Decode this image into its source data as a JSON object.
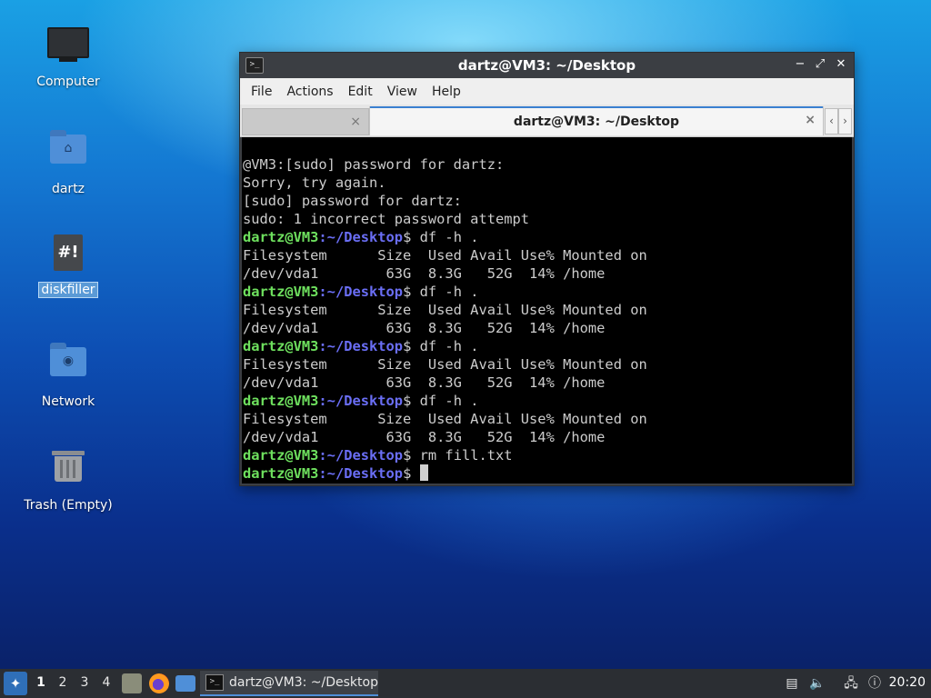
{
  "desktop": {
    "icons": [
      {
        "label": "Computer"
      },
      {
        "label": "dartz"
      },
      {
        "label": "diskfiller",
        "glyph": "#!"
      },
      {
        "label": "Network"
      },
      {
        "label": "Trash (Empty)"
      }
    ]
  },
  "window": {
    "title": "dartz@VM3: ~/Desktop",
    "app_icon": ">_",
    "controls": {
      "minimize": "−",
      "maximize": "⤢",
      "close": "✕"
    },
    "menu": [
      "File",
      "Actions",
      "Edit",
      "View",
      "Help"
    ],
    "tabs": [
      {
        "label": "",
        "close": "×"
      },
      {
        "label": "dartz@VM3: ~/Desktop",
        "close": "×",
        "active": true
      }
    ],
    "tab_scroll": {
      "left": "‹",
      "right": "›"
    }
  },
  "terminal": {
    "prompt": {
      "user": "dartz@VM3",
      "path": ":~/Desktop",
      "symbol": "$"
    },
    "lines": [
      {
        "text": "@VM3:[sudo] password for dartz:"
      },
      {
        "text": "Sorry, try again."
      },
      {
        "text": "[sudo] password for dartz:"
      },
      {
        "text": "sudo: 1 incorrect password attempt"
      },
      {
        "prompt": true,
        "cmd": " df -h ."
      },
      {
        "text": "Filesystem      Size  Used Avail Use% Mounted on"
      },
      {
        "text": "/dev/vda1        63G  8.3G   52G  14% /home"
      },
      {
        "prompt": true,
        "cmd": " df -h ."
      },
      {
        "text": "Filesystem      Size  Used Avail Use% Mounted on"
      },
      {
        "text": "/dev/vda1        63G  8.3G   52G  14% /home"
      },
      {
        "prompt": true,
        "cmd": " df -h ."
      },
      {
        "text": "Filesystem      Size  Used Avail Use% Mounted on"
      },
      {
        "text": "/dev/vda1        63G  8.3G   52G  14% /home"
      },
      {
        "prompt": true,
        "cmd": " df -h ."
      },
      {
        "text": "Filesystem      Size  Used Avail Use% Mounted on"
      },
      {
        "text": "/dev/vda1        63G  8.3G   52G  14% /home"
      },
      {
        "prompt": true,
        "cmd": " rm fill.txt"
      },
      {
        "prompt": true,
        "cmd": " ",
        "cursor": true
      }
    ]
  },
  "taskbar": {
    "workspaces": [
      "1",
      "2",
      "3",
      "4"
    ],
    "active_workspace": "1",
    "task_label": "dartz@VM3: ~/Desktop",
    "task_icon": ">_",
    "clock": "20:20"
  },
  "colors": {
    "prompt_user": "#6ee05e",
    "prompt_path": "#6a6ef5",
    "accent": "#4f8fd8"
  }
}
